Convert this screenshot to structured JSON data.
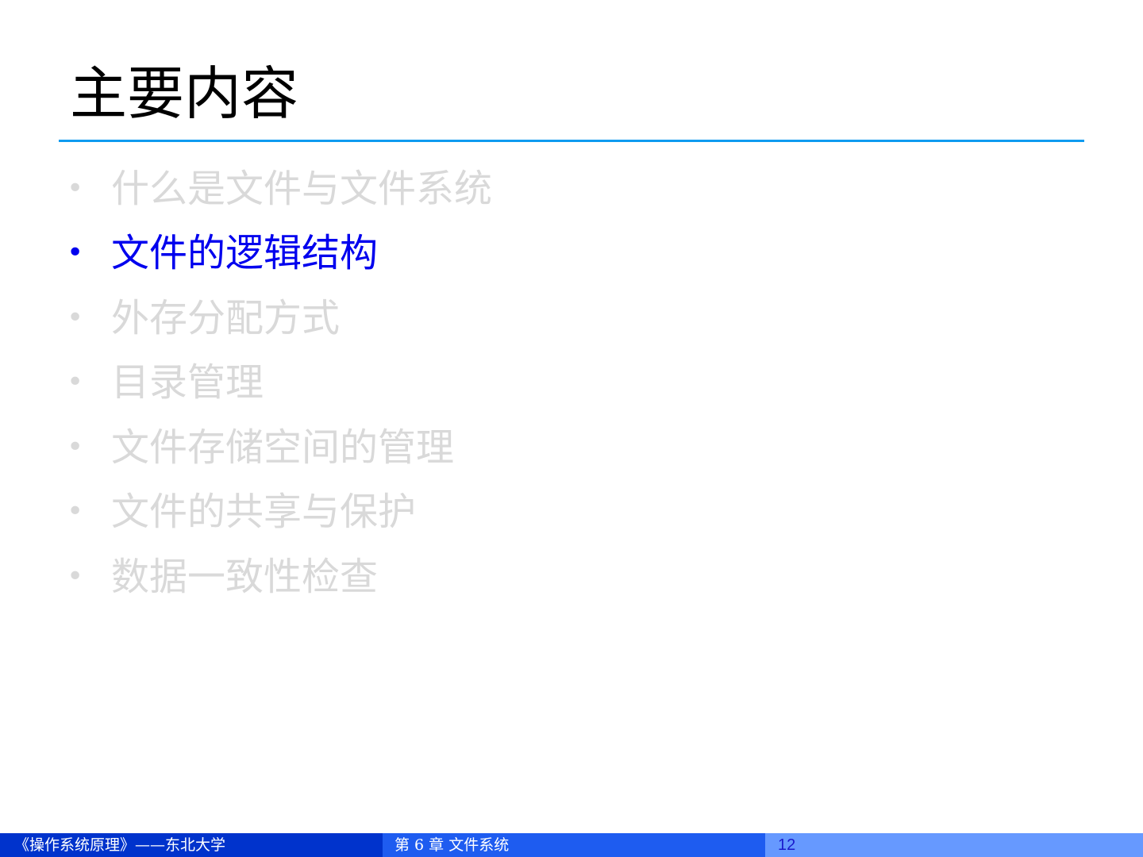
{
  "slide": {
    "title": "主要内容"
  },
  "colors": {
    "title_rule": "#0f9bf0",
    "active_bullet": "#0000ee",
    "inactive_bullet": "#d9d9d9",
    "footer_left_bg": "#0033cc",
    "footer_mid_bg": "#1e5cf0",
    "footer_right_bg": "#6699ff"
  },
  "bullets": [
    {
      "marker": "•",
      "text": "什么是文件与文件系统",
      "active": false
    },
    {
      "marker": "•",
      "text": "文件的逻辑结构",
      "active": true
    },
    {
      "marker": "•",
      "text": "外存分配方式",
      "active": false
    },
    {
      "marker": "•",
      "text": "目录管理",
      "active": false
    },
    {
      "marker": "•",
      "text": "文件存储空间的管理",
      "active": false
    },
    {
      "marker": "•",
      "text": "文件的共享与保护",
      "active": false
    },
    {
      "marker": "•",
      "text": "数据一致性检查",
      "active": false
    }
  ],
  "footer": {
    "left": "《操作系统原理》——东北大学",
    "middle": "第 6 章  文件系统",
    "page_number": "12"
  }
}
